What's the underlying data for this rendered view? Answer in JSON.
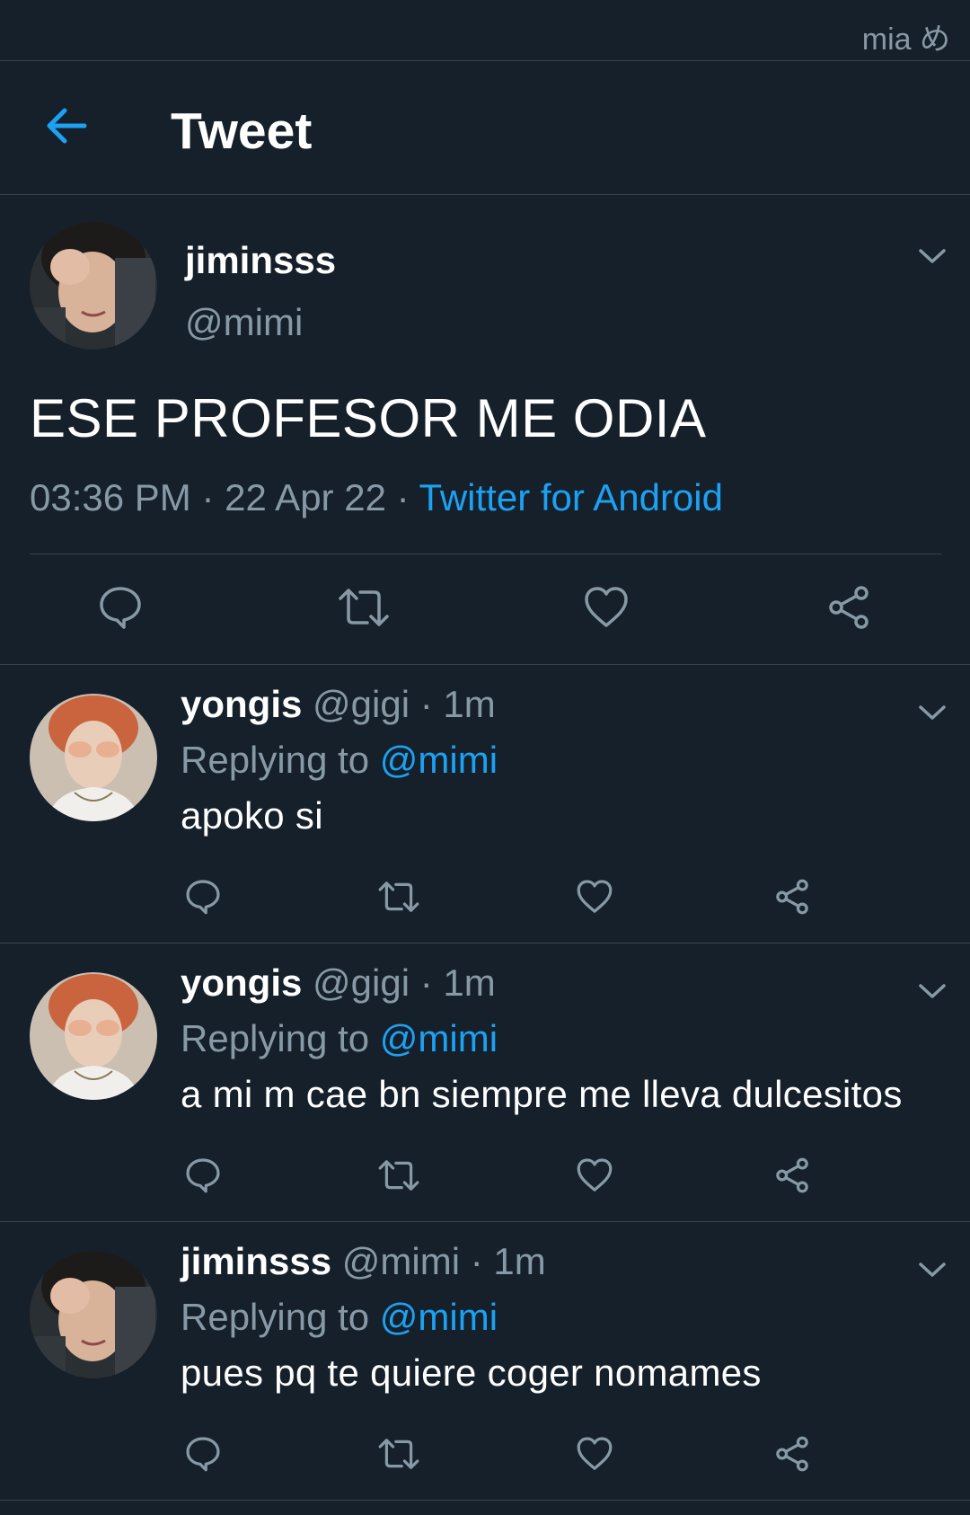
{
  "status_bar": {
    "text": "mia め"
  },
  "header": {
    "title": "Tweet"
  },
  "main_tweet": {
    "name": "jiminsss",
    "handle": "@mimi",
    "text": "ESE PROFESOR ME ODIA",
    "time": "03:36 PM",
    "separator": " · ",
    "date": "22 Apr 22",
    "source": "Twitter for Android"
  },
  "replies": [
    {
      "name": "yongis",
      "handle": "@gigi",
      "time": "1m",
      "replying_label": "Replying to",
      "mention": "@mimi",
      "text": "apoko si"
    },
    {
      "name": "yongis",
      "handle": "@gigi",
      "time": "1m",
      "replying_label": "Replying to",
      "mention": "@mimi",
      "text": "a mi m cae bn siempre me lleva dulcesitos"
    },
    {
      "name": "jiminsss",
      "handle": "@mimi",
      "time": "1m",
      "replying_label": "Replying to",
      "mention": "@mimi",
      "text": "pues pq te quiere coger nomames"
    }
  ],
  "icons": {
    "back": "arrow-left-icon",
    "caret": "chevron-down-icon",
    "reply": "comment-bubble-icon",
    "retweet": "retweet-icon",
    "like": "heart-icon",
    "share": "share-icon"
  },
  "colors": {
    "background": "#15202b",
    "accent": "#1da1f2",
    "secondary_text": "#8899a6",
    "divider": "#38444d"
  }
}
